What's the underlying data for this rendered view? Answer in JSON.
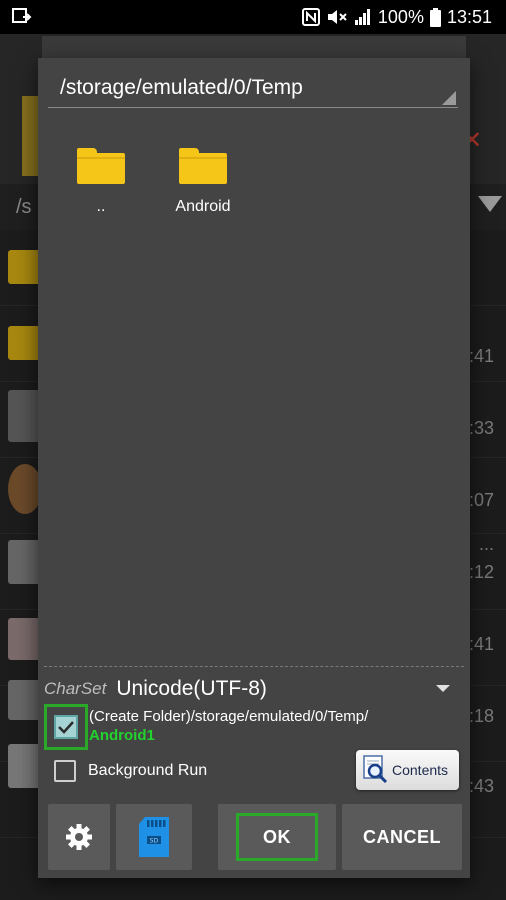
{
  "status_bar": {
    "battery_percent": "100%",
    "time": "13:51"
  },
  "background_app": {
    "path_prefix": "/s",
    "times": [
      ":41",
      ":33",
      ":07",
      "...",
      ":12",
      ":41",
      ":18",
      ":43"
    ]
  },
  "dialog": {
    "path": "/storage/emulated/0/Temp",
    "files": [
      {
        "label": "..",
        "icon": "folder-icon"
      },
      {
        "label": "Android",
        "icon": "folder-icon"
      }
    ],
    "charset": {
      "label": "CharSet",
      "value": "Unicode(UTF-8)"
    },
    "create_folder": {
      "checked": true,
      "text_prefix": "(Create Folder)/storage/emulated/0/Temp/",
      "folder_name": "Android1"
    },
    "background_run": {
      "checked": false,
      "label": "Background Run"
    },
    "contents_button": "Contents",
    "buttons": {
      "settings_icon": "gear-icon",
      "sdcard_icon": "sdcard-icon",
      "ok": "OK",
      "cancel": "CANCEL"
    }
  },
  "colors": {
    "accent_green": "#29a829",
    "folder_yellow": "#f5c518",
    "dialog_bg": "#444444",
    "button_bg": "#5a5a5a"
  }
}
